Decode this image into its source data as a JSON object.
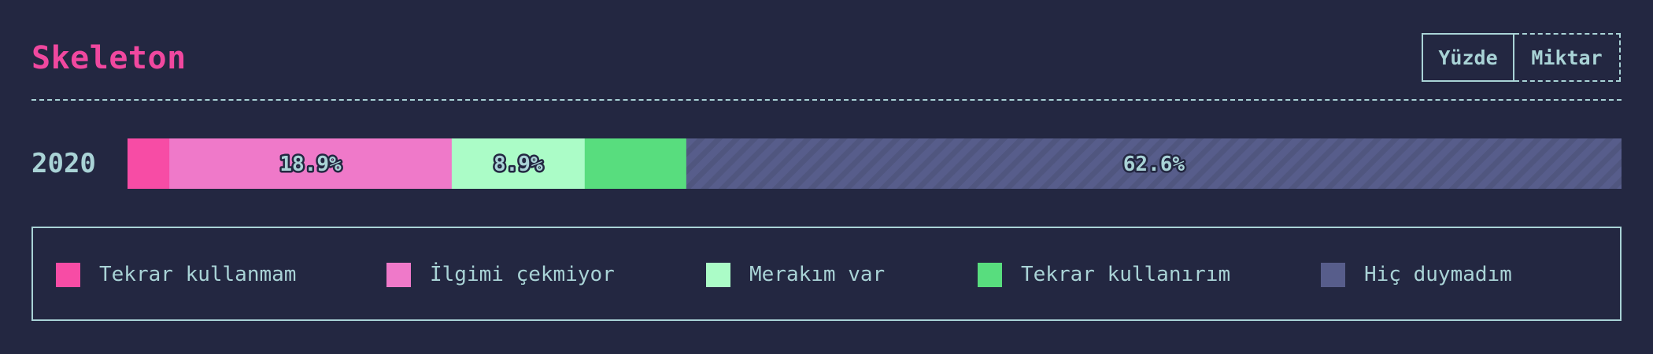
{
  "header": {
    "title": "Skeleton",
    "toggle": {
      "percent_label": "Yüzde",
      "count_label": "Miktar",
      "active": "percent"
    }
  },
  "chart_data": {
    "type": "bar",
    "orientation": "horizontal",
    "stacked": true,
    "normalized": true,
    "categories": [
      "2020"
    ],
    "series": [
      {
        "name": "Tekrar kullanmam",
        "values": [
          2.8
        ],
        "color": "#f74ca5",
        "label": ""
      },
      {
        "name": "İlgimi çekmiyor",
        "values": [
          18.9
        ],
        "color": "#ef79c9",
        "label": "18.9%"
      },
      {
        "name": "Merakım var",
        "values": [
          8.9
        ],
        "color": "#abfcc7",
        "label": "8.9%"
      },
      {
        "name": "Tekrar kullanırım",
        "values": [
          6.8
        ],
        "color": "#58dd7e",
        "label": ""
      },
      {
        "name": "Hiç duymadım",
        "values": [
          62.6
        ],
        "color": "#575d8b",
        "label": "62.6%",
        "pattern": "diagonal-stripes"
      }
    ],
    "xlim": [
      0,
      100
    ],
    "legend": "bottom",
    "grid": false
  },
  "legend": {
    "items": [
      {
        "label": "Tekrar kullanmam",
        "color": "#f74ca5"
      },
      {
        "label": "İlgimi çekmiyor",
        "color": "#ef79c9"
      },
      {
        "label": "Merakım var",
        "color": "#abfcc7"
      },
      {
        "label": "Tekrar kullanırım",
        "color": "#58dd7e"
      },
      {
        "label": "Hiç duymadım",
        "color": "#575d8b"
      }
    ]
  }
}
